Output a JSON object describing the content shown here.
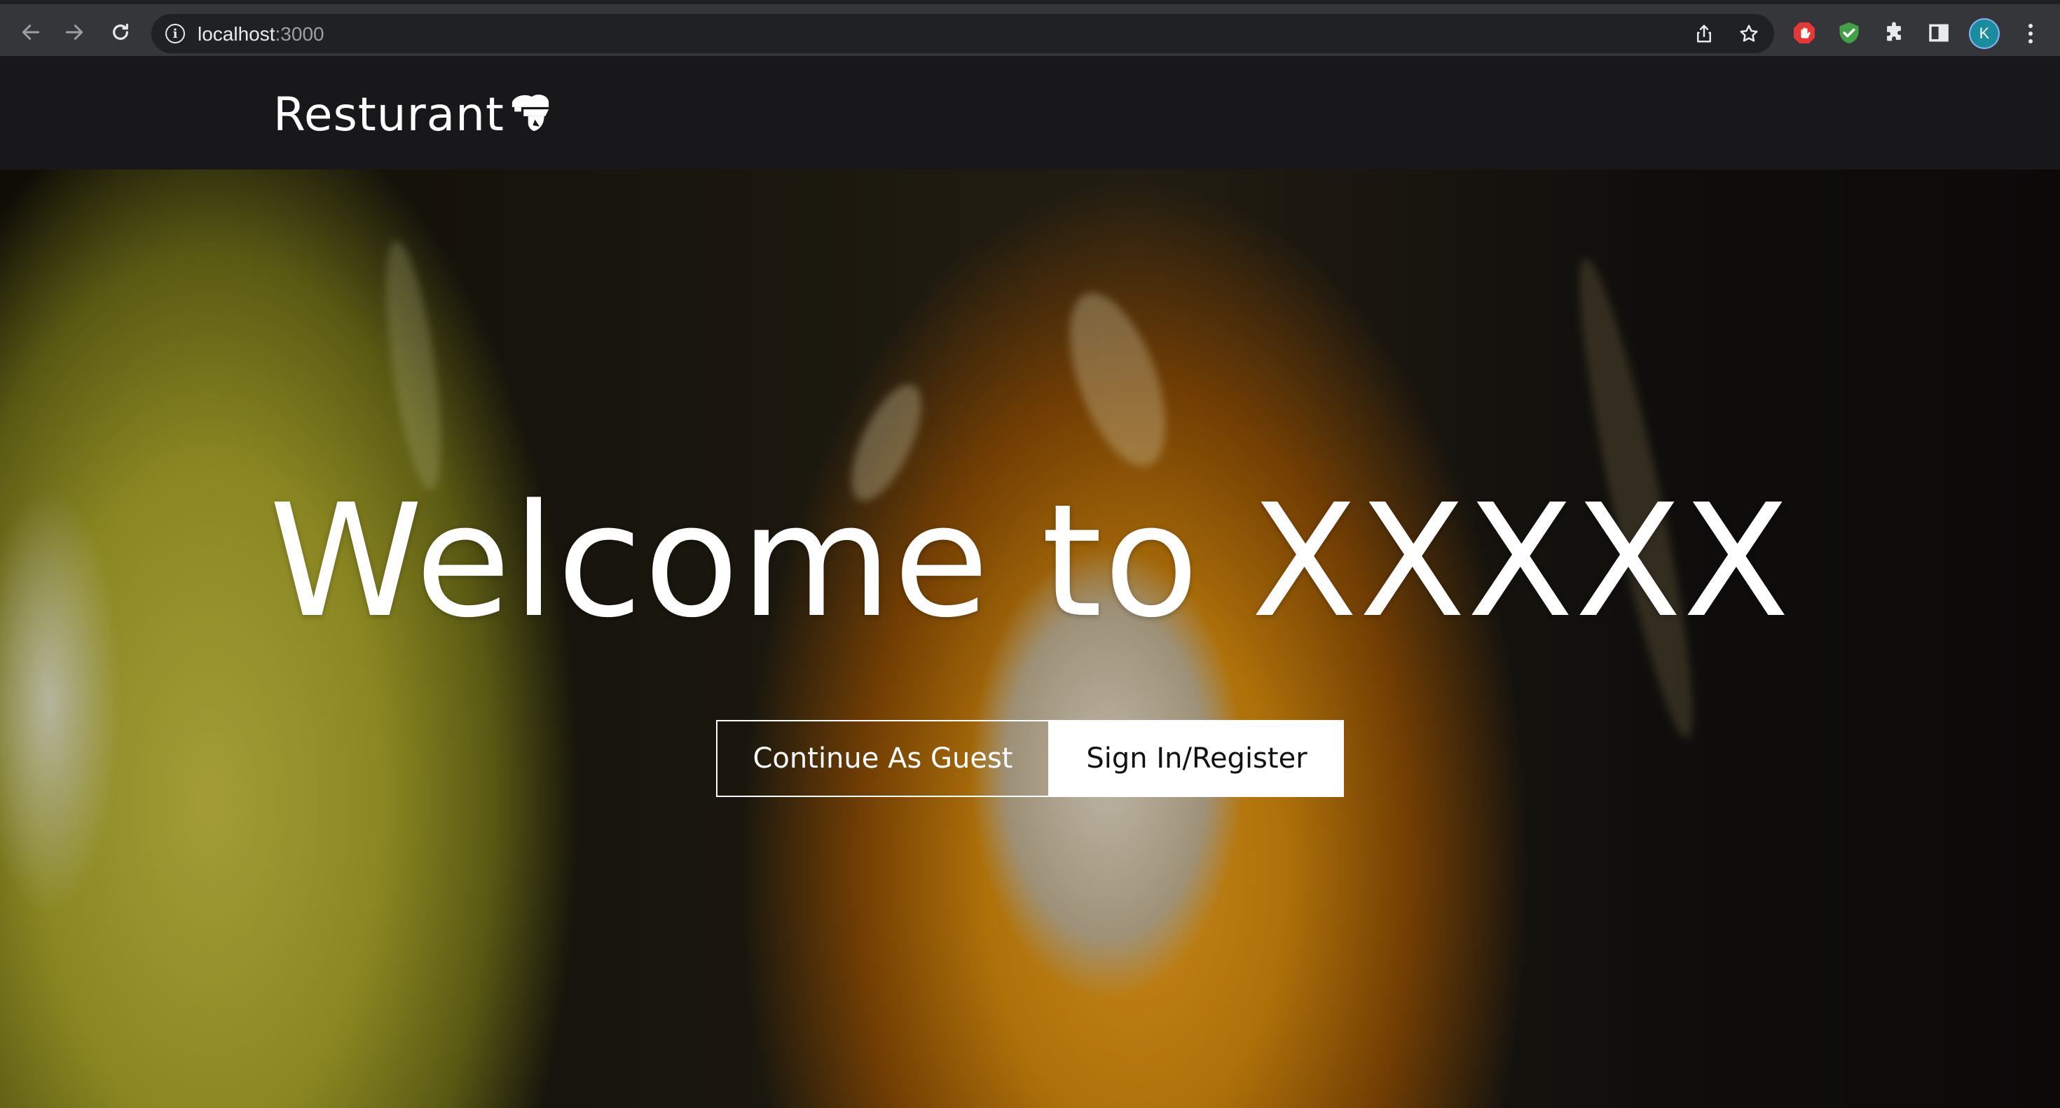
{
  "browser": {
    "url_host": "localhost",
    "url_port": ":3000",
    "profile_initial": "K",
    "colors": {
      "ext_red": "#e53935",
      "ext_green": "#43a047",
      "avatar": "#1a8ca0"
    },
    "icons": [
      "back-arrow-icon",
      "forward-arrow-icon",
      "reload-icon",
      "site-info-icon",
      "share-icon",
      "star-icon",
      "puzzle-icon",
      "side-panel-icon",
      "more-vert-icon"
    ]
  },
  "header": {
    "brand": "Resturant",
    "logo_icon": "chef-hat-icon",
    "background": "#18171a"
  },
  "hero": {
    "title": "Welcome to XXXXX",
    "guest_button": "Continue As Guest",
    "signin_button": "Sign In/Register"
  }
}
